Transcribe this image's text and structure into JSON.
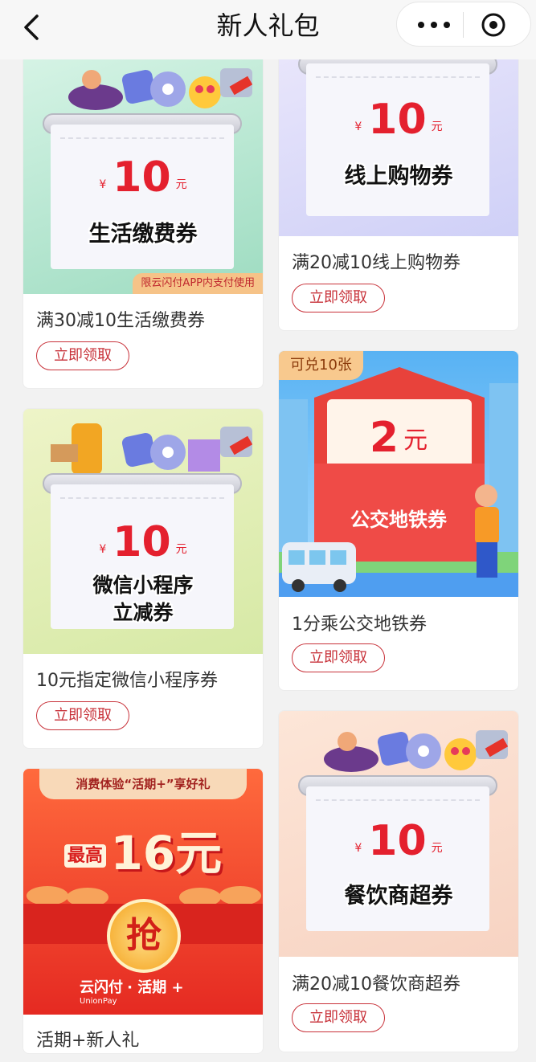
{
  "header": {
    "title": "新人礼包"
  },
  "cards": [
    {
      "coupon_amount": "10",
      "coupon_currency": "¥",
      "coupon_unit": "元",
      "coupon_title": "生活缴费券",
      "note": "限云闪付APP内支付使用",
      "name": "满30减10生活缴费券",
      "button": "立即领取"
    },
    {
      "coupon_amount": "10",
      "coupon_currency": "¥",
      "coupon_unit": "元",
      "coupon_title": "线上购物券",
      "name": "满20减10线上购物券",
      "button": "立即领取"
    },
    {
      "badge": "可兑10张",
      "coupon_amount": "2",
      "coupon_unit": "元",
      "coupon_title": "公交地铁券",
      "name": "1分乘公交地铁券",
      "button": "立即领取"
    },
    {
      "coupon_amount": "10",
      "coupon_currency": "¥",
      "coupon_unit": "元",
      "coupon_title_line1": "微信小程序",
      "coupon_title_line2": "立减券",
      "name": "10元指定微信小程序券",
      "button": "立即领取"
    },
    {
      "promo_top": "消费体验“活期+”享好礼",
      "promo_pre": "最高",
      "promo_amount": "16元",
      "promo_grab": "抢",
      "brand": "云闪付",
      "brand_en": "UnionPay",
      "brand_product": "· 活期 +",
      "name": "活期+新人礼"
    },
    {
      "coupon_amount": "10",
      "coupon_currency": "¥",
      "coupon_unit": "元",
      "coupon_title": "餐饮商超券",
      "name": "满20减10餐饮商超券",
      "button": "立即领取"
    }
  ]
}
